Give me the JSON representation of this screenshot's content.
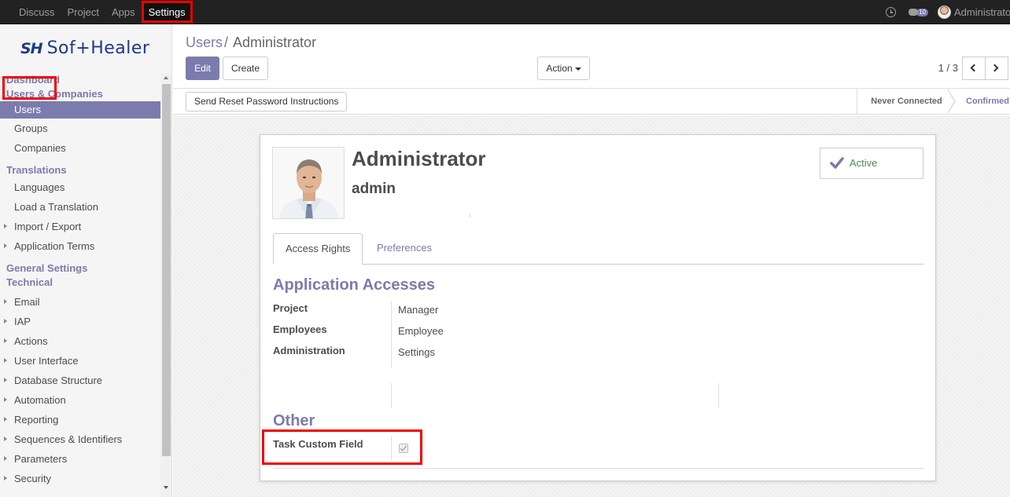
{
  "topbar": {
    "menu": [
      "Discuss",
      "Project",
      "Apps",
      "Settings"
    ],
    "active_menu": "Settings",
    "message_count": "10",
    "user_name": "Administrator"
  },
  "sidebar": {
    "logo_mark": "SH",
    "logo_text": "Sof+Healer",
    "items": [
      {
        "type": "section",
        "label": "Dashboard"
      },
      {
        "type": "section",
        "label": "Users & Companies"
      },
      {
        "type": "item",
        "label": "Users",
        "selected": true
      },
      {
        "type": "item",
        "label": "Groups"
      },
      {
        "type": "item",
        "label": "Companies"
      },
      {
        "type": "section",
        "label": "Translations"
      },
      {
        "type": "item",
        "label": "Languages"
      },
      {
        "type": "item",
        "label": "Load a Translation"
      },
      {
        "type": "item",
        "label": "Import / Export",
        "caret": true
      },
      {
        "type": "item",
        "label": "Application Terms",
        "caret": true
      },
      {
        "type": "section",
        "label": "General Settings"
      },
      {
        "type": "section",
        "label": "Technical"
      },
      {
        "type": "item",
        "label": "Email",
        "caret": true
      },
      {
        "type": "item",
        "label": "IAP",
        "caret": true
      },
      {
        "type": "item",
        "label": "Actions",
        "caret": true
      },
      {
        "type": "item",
        "label": "User Interface",
        "caret": true
      },
      {
        "type": "item",
        "label": "Database Structure",
        "caret": true
      },
      {
        "type": "item",
        "label": "Automation",
        "caret": true
      },
      {
        "type": "item",
        "label": "Reporting",
        "caret": true
      },
      {
        "type": "item",
        "label": "Sequences & Identifiers",
        "caret": true
      },
      {
        "type": "item",
        "label": "Parameters",
        "caret": true
      },
      {
        "type": "item",
        "label": "Security",
        "caret": true
      }
    ]
  },
  "control_panel": {
    "breadcrumb_parent": "Users",
    "breadcrumb_separator": "/",
    "breadcrumb_current": "Administrator",
    "edit_label": "Edit",
    "create_label": "Create",
    "action_label": "Action",
    "pager": "1 / 3"
  },
  "statusbar": {
    "reset_button": "Send Reset Password Instructions",
    "stages": [
      "Never Connected",
      "Confirmed"
    ]
  },
  "form": {
    "name": "Administrator",
    "login": "admin",
    "active_label": "Active",
    "tabs": [
      "Access Rights",
      "Preferences"
    ],
    "section_app_accesses": "Application Accesses",
    "accesses": [
      {
        "label": "Project",
        "value": "Manager"
      },
      {
        "label": "Employees",
        "value": "Employee"
      },
      {
        "label": "Administration",
        "value": "Settings"
      }
    ],
    "section_other": "Other",
    "custom_field_label": "Task Custom Field",
    "custom_field_checked": true
  },
  "colors": {
    "accent": "#7c7bad",
    "navbar": "#222222",
    "highlight": "#ee0000"
  }
}
